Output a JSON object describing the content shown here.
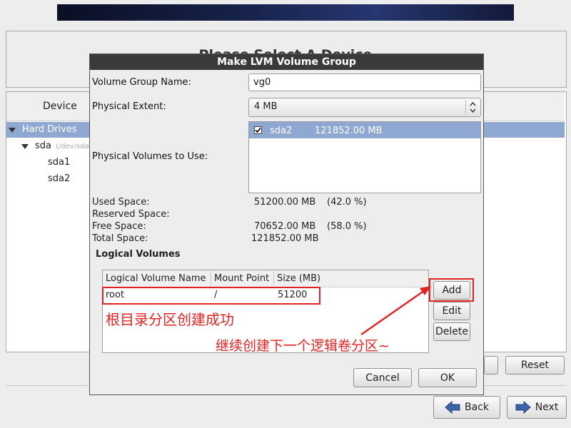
{
  "background": {
    "heading": "Please Select A Device",
    "column_device": "Device",
    "tree": {
      "hard_drives": "Hard Drives",
      "sda": "sda",
      "sda_path": "(/dev/sda)",
      "sda1": "sda1",
      "sda2": "sda2"
    },
    "buttons": {
      "reset": "Reset",
      "back": "Back",
      "next": "Next"
    }
  },
  "dialog": {
    "title": "Make LVM Volume Group",
    "vg_name_label": "Volume Group Name:",
    "vg_name_value": "vg0",
    "extent_label": "Physical Extent:",
    "extent_value": "4 MB",
    "pv_label": "Physical Volumes to Use:",
    "physical_volumes": [
      {
        "checked": true,
        "name": "sda2",
        "size": "121852.00 MB"
      }
    ],
    "stats": {
      "used_label": "Used Space:",
      "used_value": "51200.00 MB",
      "used_pct": "(42.0 %)",
      "reserved_label": "Reserved Space:",
      "free_label": "Free Space:",
      "free_value": "70652.00 MB",
      "free_pct": "(58.0 %)",
      "total_label": "Total Space:",
      "total_value": "121852.00 MB"
    },
    "lv_heading": "Logical Volumes",
    "lv_columns": [
      "Logical Volume Name",
      "Mount Point",
      "Size (MB)"
    ],
    "lv_rows": [
      {
        "name": "root",
        "mount": "/",
        "size": "51200"
      }
    ],
    "lv_buttons": {
      "add": "Add",
      "edit": "Edit",
      "delete": "Delete"
    },
    "cancel": "Cancel",
    "ok": "OK"
  },
  "annotations": {
    "success": "根目录分区创建成功",
    "next_step": "继续创建下一个逻辑卷分区~",
    "color": "#e52222"
  },
  "colors": {
    "selection": "#8fa8d2",
    "title_bar": "#3a3a3a",
    "banner": "#17224a"
  }
}
